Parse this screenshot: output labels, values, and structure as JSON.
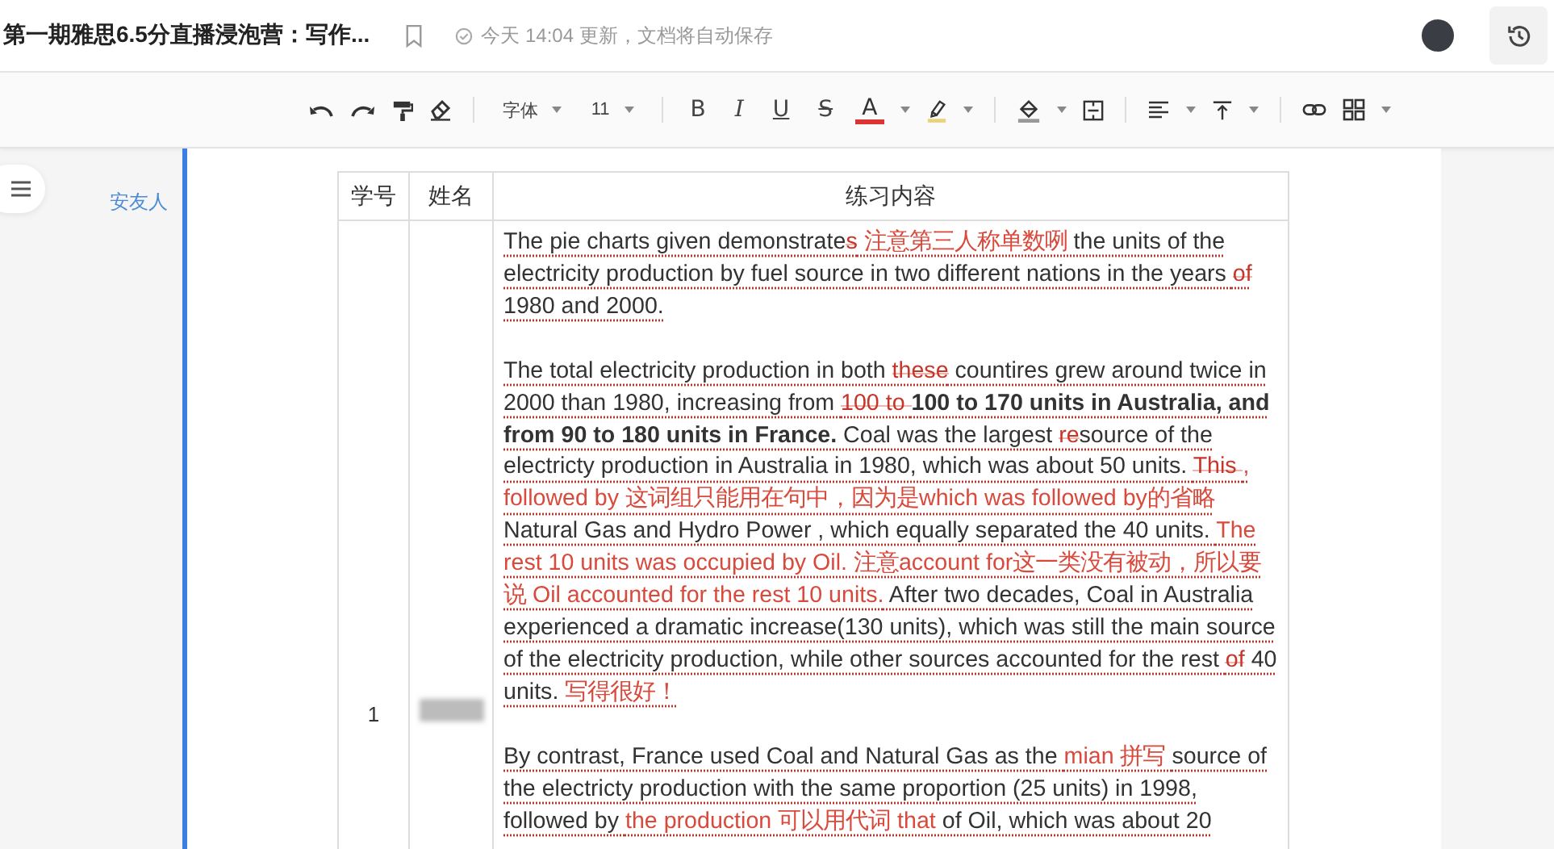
{
  "header": {
    "title": "第一期雅思6.5分直播浸泡营：写作...",
    "save_status": "今天 14:04 更新，文档将自动保存"
  },
  "toolbar": {
    "font": "字体",
    "size": "11",
    "bold": "B",
    "italic": "I",
    "underline": "U",
    "strike": "S",
    "font_color_label": "A"
  },
  "sidebar": {
    "author": "安友人"
  },
  "table": {
    "columns": [
      "学号",
      "姓名",
      "练习内容"
    ],
    "rows": [
      {
        "number": "1",
        "paragraphs": [
          [
            {
              "kind": "plain",
              "text": "The pie charts given demonstrate"
            },
            {
              "kind": "strike",
              "text": "s"
            },
            {
              "kind": "comment",
              "text": " 注意第三人称单数咧 "
            },
            {
              "kind": "plain",
              "text": "the units of the electricity production by fuel source in two different nations in the years "
            },
            {
              "kind": "strike",
              "text": "of"
            },
            {
              "kind": "plain",
              "text": " 1980 and 2000."
            }
          ],
          [
            {
              "kind": "plain",
              "text": "The total electricity production in both "
            },
            {
              "kind": "strike",
              "text": "these"
            },
            {
              "kind": "plain",
              "text": " countires grew around twice in 2000 than 1980, increasing from "
            },
            {
              "kind": "strike",
              "text": "100 to "
            },
            {
              "kind": "bold",
              "text": " 100 to 170 units in Australia, and from 90 to 180 units in France."
            },
            {
              "kind": "plain",
              "text": " Coal was the largest "
            },
            {
              "kind": "strike",
              "text": "re"
            },
            {
              "kind": "plain",
              "text": "source of the electricty production in Australia in 1980, which was about 50 units. "
            },
            {
              "kind": "strike",
              "text": "This "
            },
            {
              "kind": "comment",
              "text": " , followed by 这词组只能用在句中，因为是which was followed by的省略 "
            },
            {
              "kind": "plain",
              "text": "Natural Gas and Hydro Power , which  equally separated the 40 units. "
            },
            {
              "kind": "comment",
              "text": "The rest 10 units was occupied by Oil. 注意account for这一类没有被动，所以要说 Oil accounted for the rest 10 units."
            },
            {
              "kind": "plain",
              "text": " After two decades, Coal in Australia experienced a dramatic increase(130 units), which was still the main source of the electricity production, while other sources accounted for the rest "
            },
            {
              "kind": "strike",
              "text": "of"
            },
            {
              "kind": "plain",
              "text": " 40 units. "
            },
            {
              "kind": "comment",
              "text": "写得很好！"
            }
          ],
          [
            {
              "kind": "plain",
              "text": "By contrast, France used Coal and Natural Gas as the "
            },
            {
              "kind": "comment",
              "text": "mian 拼写 "
            },
            {
              "kind": "plain",
              "text": "source of the electricty production with the same proportion (25 units) in 1998, followed by "
            },
            {
              "kind": "comment",
              "text": "the production 可以用代词 that"
            },
            {
              "kind": "plain",
              "text": " of Oil, which was about 20"
            }
          ]
        ]
      }
    ]
  }
}
